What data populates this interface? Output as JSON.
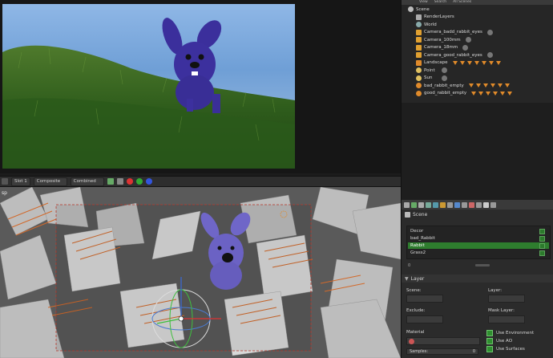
{
  "outliner": {
    "header": [
      "View",
      "Search",
      "All Scenes"
    ],
    "rows": [
      {
        "label": "Scene",
        "icon": "scene-icon"
      },
      {
        "label": "RenderLayers",
        "icon": "render-layers-icon"
      },
      {
        "label": "World",
        "icon": "world-icon"
      },
      {
        "label": "Camera_badd_rabbit_eyes",
        "icon": "camera-icon"
      },
      {
        "label": "Camera_100mm",
        "icon": "camera-icon"
      },
      {
        "label": "Camera_18mm",
        "icon": "camera-icon"
      },
      {
        "label": "Camera_good_rabbit_eyes",
        "icon": "camera-icon"
      },
      {
        "label": "Landscape",
        "icon": "mesh-icon"
      },
      {
        "label": "Point",
        "icon": "lamp-icon"
      },
      {
        "label": "Sun",
        "icon": "lamp-icon"
      },
      {
        "label": "bad_rabbit_empty",
        "icon": "empty-icon"
      },
      {
        "label": "good_rabbit_empty",
        "icon": "empty-icon"
      }
    ]
  },
  "image_editor": {
    "slot": "Slot 1",
    "pass": "Composite",
    "view": "Combined"
  },
  "properties": {
    "scene_label": "Scene",
    "layers": [
      {
        "name": "Decor",
        "selected": false
      },
      {
        "name": "bad_Rabbit",
        "selected": false
      },
      {
        "name": "Rabbit",
        "selected": true
      },
      {
        "name": "Grass2",
        "selected": false
      }
    ],
    "list_count": "0",
    "panel_title": "Layer",
    "scene_field": "Scene:",
    "layer_field": "Layer:",
    "exclude_field": "Exclude:",
    "mask_layer_field": "Mask Layer:",
    "material_label": "Material",
    "samples_label": "Samples:",
    "samples_value": "0",
    "options": [
      "Use Environment",
      "Use AO",
      "Use Surfaces"
    ]
  },
  "viewport": {
    "label": "sp"
  },
  "colors": {
    "selected_row": "#2e7d2e",
    "accent_orange": "#e08a2a",
    "panel_bg": "#2b2b2b"
  }
}
